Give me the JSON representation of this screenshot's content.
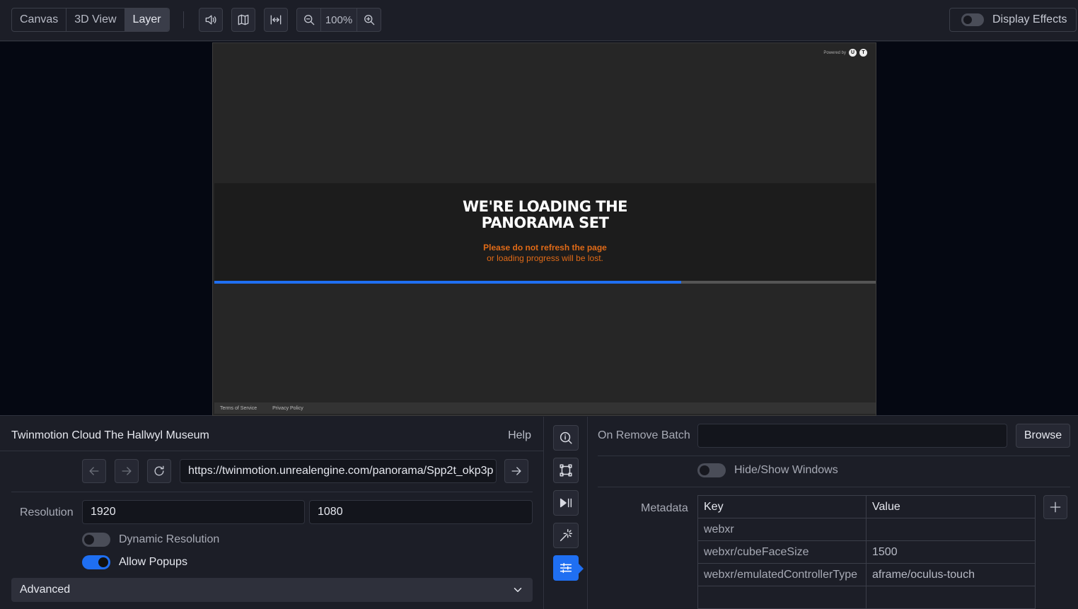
{
  "toolbar": {
    "tabs": [
      {
        "label": "Canvas"
      },
      {
        "label": "3D View"
      },
      {
        "label": "Layer"
      }
    ],
    "active_tab": "Layer",
    "icons": [
      "speaker-icon",
      "map-icon",
      "fit-width-icon"
    ],
    "zoom": {
      "value": "100%",
      "icons": [
        "zoom-out-icon",
        "zoom-in-icon"
      ]
    },
    "display_effects": {
      "label": "Display Effects",
      "enabled": false
    }
  },
  "preview": {
    "powered_by": "Powered by",
    "loading_title": "WE'RE LOADING THE\nPANORAMA SET",
    "warning_line1": "Please do not refresh the page",
    "warning_line2": "or loading progress will be lost.",
    "progress": 0.706,
    "footer": {
      "terms": "Terms of Service",
      "privacy": "Privacy Policy"
    },
    "colors": {
      "progress": "#1f6ff2",
      "warning": "#e06a17"
    }
  },
  "layer_panel": {
    "title": "Twinmotion Cloud  The Hallwyl Museum",
    "help": "Help",
    "nav_icons": [
      "back-arrow-icon",
      "forward-arrow-icon",
      "reload-icon",
      "go-arrow-icon"
    ],
    "url": "https://twinmotion.unrealengine.com/panorama/Spp2t_okp3p",
    "resolution": {
      "label": "Resolution",
      "width": "1920",
      "height": "1080"
    },
    "dynamic_resolution": {
      "label": "Dynamic Resolution",
      "enabled": false
    },
    "allow_popups": {
      "label": "Allow Popups",
      "enabled": true
    },
    "advanced": {
      "label": "Advanced",
      "icon": "chevron-down-icon"
    }
  },
  "sidebar": {
    "icons": [
      "info-search-icon",
      "transform-icon",
      "play-pause-icon",
      "magic-wand-icon",
      "sliders-icon"
    ],
    "active": "sliders-icon"
  },
  "properties": {
    "on_remove_batch": {
      "label": "On Remove Batch",
      "value": ""
    },
    "browse": "Browse",
    "hide_show_windows": {
      "label": "Hide/Show Windows",
      "enabled": false
    },
    "metadata": {
      "label": "Metadata",
      "columns": [
        "Key",
        "Value"
      ],
      "rows": [
        {
          "key": "webxr",
          "value": ""
        },
        {
          "key": "webxr/cubeFaceSize",
          "value": "1500"
        },
        {
          "key": "webxr/emulatedControllerType",
          "value": "aframe/oculus-touch"
        },
        {
          "key": "",
          "value": ""
        }
      ],
      "add_icon": "plus-icon"
    }
  }
}
